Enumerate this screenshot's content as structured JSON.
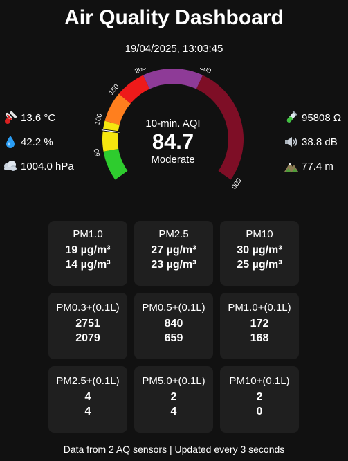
{
  "header": {
    "title": "Air Quality Dashboard",
    "timestamp": "19/04/2025, 13:03:45"
  },
  "left_readings": [
    {
      "icon": "thermometer-icon",
      "value": "13.6 °C"
    },
    {
      "icon": "water-drop-icon",
      "value": "42.2 %"
    },
    {
      "icon": "fog-icon",
      "value": "1004.0 hPa"
    }
  ],
  "right_readings": [
    {
      "icon": "test-tube-icon",
      "value": "95808 Ω"
    },
    {
      "icon": "speaker-icon",
      "value": "38.8 dB"
    },
    {
      "icon": "mountain-icon",
      "value": "77.4 m"
    }
  ],
  "gauge": {
    "label": "10-min. AQI",
    "value": 84.7,
    "value_text": "84.7",
    "category": "Moderate",
    "max": 500,
    "tick_labels": [
      "50",
      "100",
      "150",
      "200",
      "300",
      "500"
    ],
    "colors": {
      "good": "#2ecc2e",
      "moderate": "#f5e60f",
      "usg": "#ff7f1e",
      "unhealthy": "#ee1a1a",
      "very_unhealthy": "#8e3b97",
      "hazardous": "#7e0e26"
    }
  },
  "pm_cards": [
    {
      "title": "PM1.0",
      "v1": "19 µg/m³",
      "v2": "14 µg/m³"
    },
    {
      "title": "PM2.5",
      "v1": "27 µg/m³",
      "v2": "23 µg/m³"
    },
    {
      "title": "PM10",
      "v1": "30 µg/m³",
      "v2": "25 µg/m³"
    },
    {
      "title": "PM0.3+(0.1L)",
      "v1": "2751",
      "v2": "2079"
    },
    {
      "title": "PM0.5+(0.1L)",
      "v1": "840",
      "v2": "659"
    },
    {
      "title": "PM1.0+(0.1L)",
      "v1": "172",
      "v2": "168"
    },
    {
      "title": "PM2.5+(0.1L)",
      "v1": "4",
      "v2": "4"
    },
    {
      "title": "PM5.0+(0.1L)",
      "v1": "2",
      "v2": "4"
    },
    {
      "title": "PM10+(0.1L)",
      "v1": "2",
      "v2": "0"
    }
  ],
  "footer": "Data from 2 AQ sensors | Updated every 3 seconds"
}
